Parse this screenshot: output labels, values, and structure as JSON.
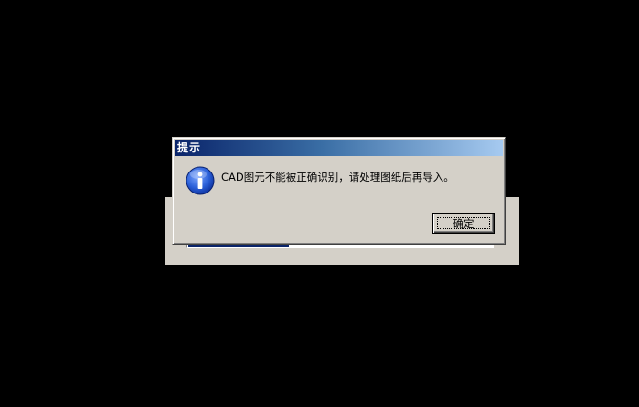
{
  "dialog": {
    "title": "提示",
    "icon": "info-icon",
    "message": "CAD图元不能被正确识别，请处理图纸后再导入。",
    "ok_label": "确定"
  },
  "background_window": {
    "progress_fraction": 0.33
  },
  "colors": {
    "titlebar_start": "#0a246a",
    "titlebar_end": "#a6caf0",
    "window_face": "#d4d0c8",
    "desktop": "#000000"
  }
}
